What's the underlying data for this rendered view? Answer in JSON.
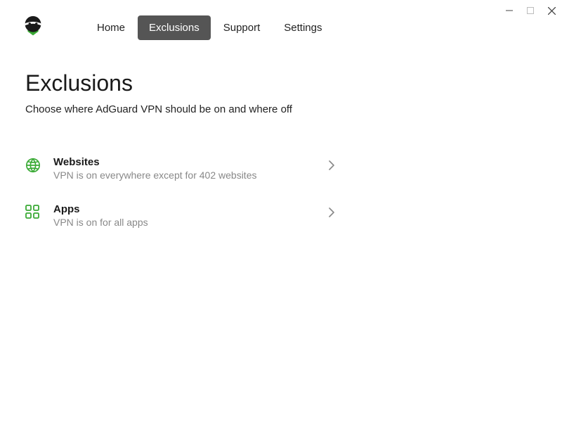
{
  "window_controls": {
    "minimize": "minimize",
    "maximize": "maximize",
    "close": "close"
  },
  "nav": {
    "items": [
      {
        "label": "Home",
        "active": false
      },
      {
        "label": "Exclusions",
        "active": true
      },
      {
        "label": "Support",
        "active": false
      },
      {
        "label": "Settings",
        "active": false
      }
    ]
  },
  "page": {
    "title": "Exclusions",
    "subtitle": "Choose where AdGuard VPN should be on and where off"
  },
  "options": {
    "websites": {
      "title": "Websites",
      "description": "VPN is on everywhere except for 402 websites"
    },
    "apps": {
      "title": "Apps",
      "description": "VPN is on for all apps"
    }
  },
  "colors": {
    "accent": "#2e7d32",
    "nav_active_bg": "#555555"
  }
}
